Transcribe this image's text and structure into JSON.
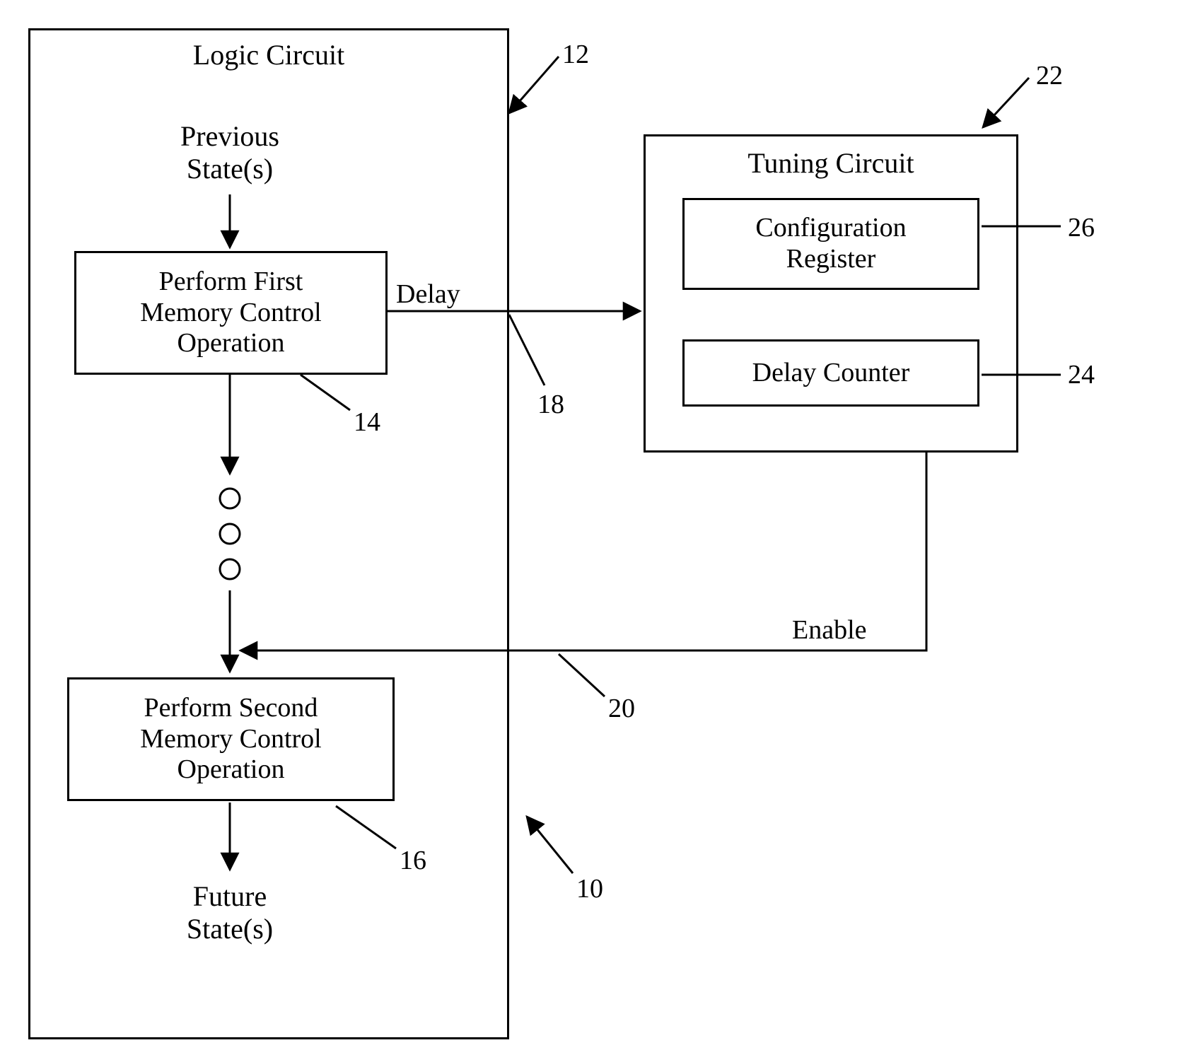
{
  "logic_circuit": {
    "title": "Logic Circuit",
    "prev_state": "Previous\nState(s)",
    "box_first": "Perform First\nMemory Control\nOperation",
    "box_second": "Perform Second\nMemory Control\nOperation",
    "future_state": "Future\nState(s)"
  },
  "tuning_circuit": {
    "title": "Tuning Circuit",
    "config_reg": "Configuration\nRegister",
    "delay_counter": "Delay Counter"
  },
  "signals": {
    "delay": "Delay",
    "enable": "Enable"
  },
  "refs": {
    "r10": "10",
    "r12": "12",
    "r14": "14",
    "r16": "16",
    "r18": "18",
    "r20": "20",
    "r22": "22",
    "r24": "24",
    "r26": "26"
  }
}
